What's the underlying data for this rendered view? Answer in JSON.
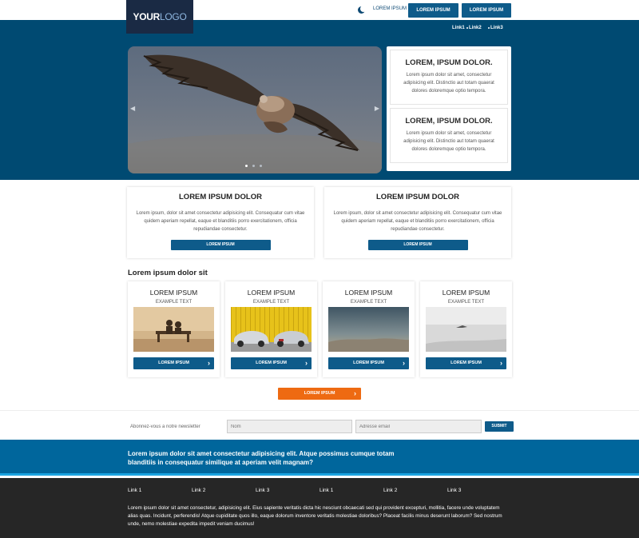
{
  "header": {
    "logo": {
      "part1": "YOUR",
      "part2": "LOGO"
    },
    "link": "LOREM IPSUM",
    "button1": "LOREM IPSUM",
    "button2": "LOREM IPSUM"
  },
  "nav": {
    "links": [
      "Link1",
      "Link2",
      "Link3"
    ]
  },
  "hero": {
    "side_cards": [
      {
        "title": "LOREM, IPSUM DOLOR.",
        "text": "Lorem ipsum dolor sit amet, consectetur adipisicing elit. Distinctio aut totam quaerat dolores doloremque optio tempora."
      },
      {
        "title": "LOREM, IPSUM DOLOR.",
        "text": "Lorem ipsum dolor sit amet, consectetur adipisicing elit. Distinctio aut totam quaerat dolores doloremque optio tempora."
      }
    ]
  },
  "features": [
    {
      "title": "LOREM IPSUM DOLOR",
      "text": "Lorem ipsum, dolor sit amet consectetur adipisicing elit. Consequatur cum vitae quidem aperiam repellat, eaque et blanditiis porro exercitationem, officia repudiandae consectetur.",
      "button": "LOREM IPSUM"
    },
    {
      "title": "LOREM IPSUM DOLOR",
      "text": "Lorem ipsum, dolor sit amet consectetur adipisicing elit. Consequatur cum vitae quidem aperiam repellat, eaque et blanditiis porro exercitationem, officia repudiandae consectetur.",
      "button": "LOREM IPSUM"
    }
  ],
  "products_section": {
    "title": "Lorem ipsum dolor sit",
    "cards": [
      {
        "title": "LOREM IPSUM",
        "subtitle": "EXAMPLE TEXT",
        "button": "LOREM IPSUM"
      },
      {
        "title": "LOREM IPSUM",
        "subtitle": "EXAMPLE TEXT",
        "button": "LOREM IPSUM"
      },
      {
        "title": "LOREM IPSUM",
        "subtitle": "EXAMPLE TEXT",
        "button": "LOREM IPSUM"
      },
      {
        "title": "LOREM IPSUM",
        "subtitle": "EXAMPLE TEXT",
        "button": "LOREM IPSUM"
      }
    ],
    "cta": "LOREM IPSUM"
  },
  "newsletter": {
    "label": "Abonnez-vous a notre newsletter",
    "name_placeholder": "Nom",
    "email_placeholder": "Adresse email",
    "submit": "SUBMIT"
  },
  "banner": {
    "text": "Lorem ipsum dolor sit amet consectetur adipisicing elit. Atque possimus cumque totam blanditiis in consequatur similique at aperiam velit magnam?"
  },
  "footer": {
    "links": [
      "Link 1",
      "Link 2",
      "Link 3",
      "Link 1",
      "Link 2",
      "Link 3"
    ],
    "text": "Lorem ipsum dolor sit amet consectetur, adipisicing elit. Eius sapiente veritatis dicta hic nesciunt obcaecati sed qui provident excepturi, mollitia, facere unde voluptatem alias quas. Incidunt, perferendis! Atque cupiditate quos illo, eaque dolorum inventore veritatis molestiae doloribus? Placeat facilis minus deserunt laborum? Sed nostrum unde, nemo molestiae expedita impedit veniam ducimus!"
  },
  "colors": {
    "primary": "#0e5b8a",
    "hero_bg": "#004a72",
    "accent": "#ee6a12",
    "banner": "#00669c",
    "footer": "#262626"
  }
}
